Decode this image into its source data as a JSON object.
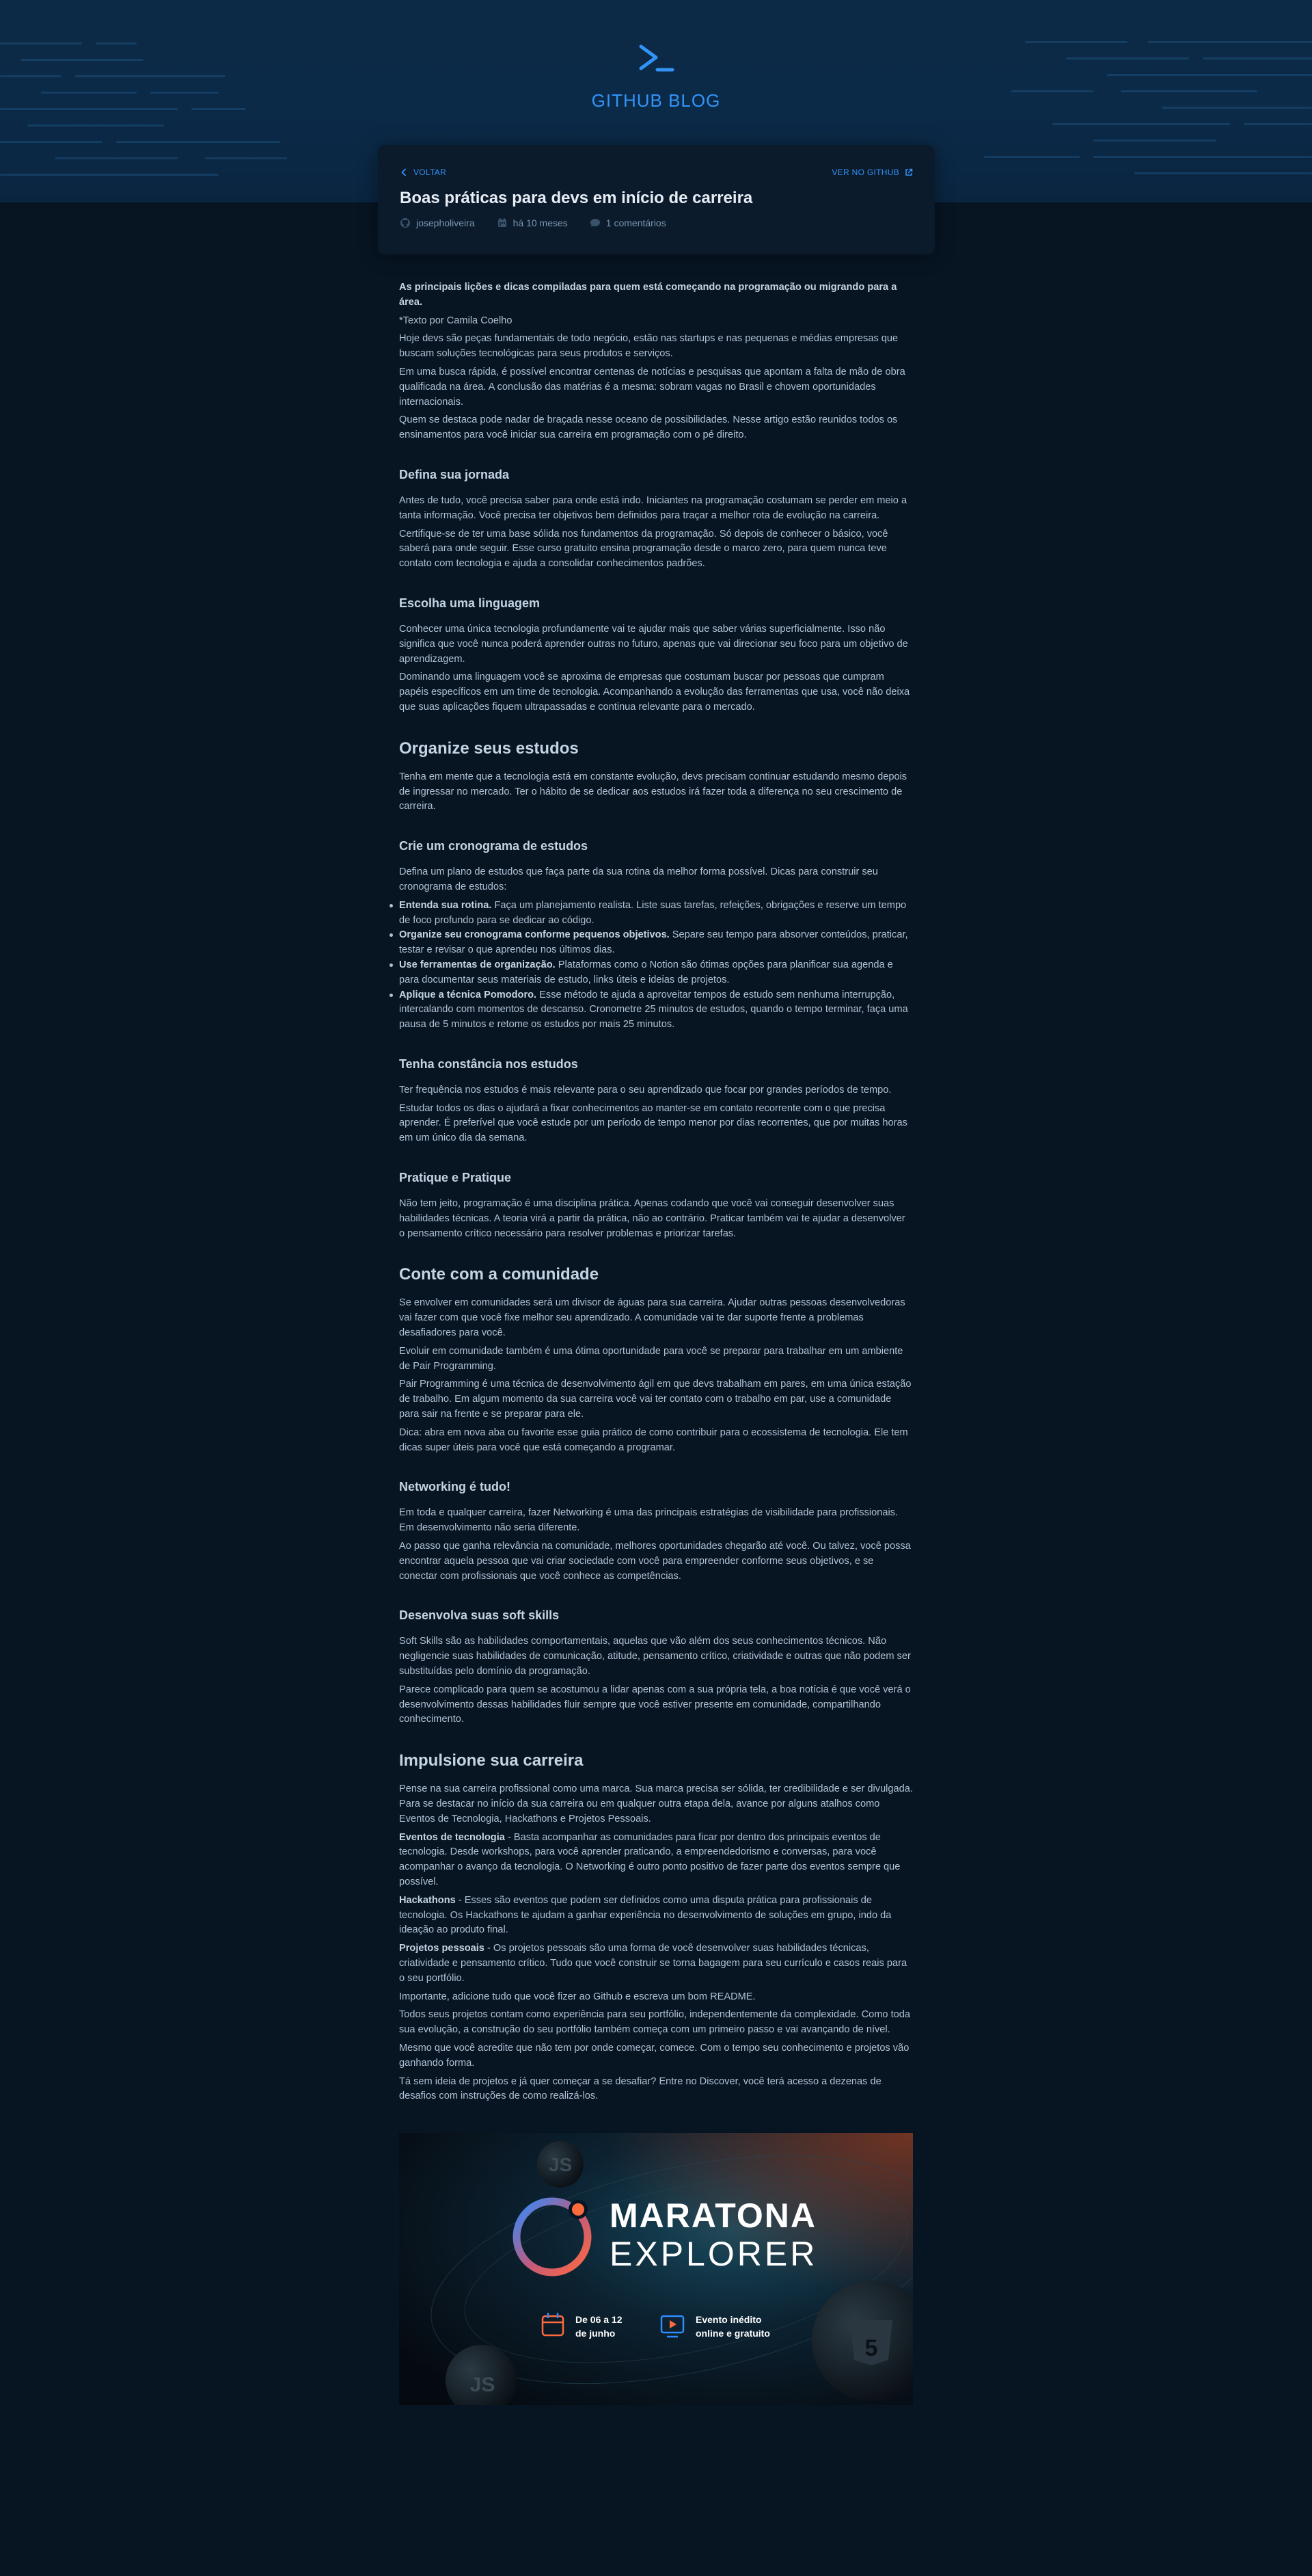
{
  "brand": {
    "name": "GITHUB BLOG",
    "accent": "#3294F8"
  },
  "post": {
    "back_label": "VOLTAR",
    "github_label": "VER NO GITHUB",
    "title": "Boas práticas para devs em início de carreira",
    "author": "josepholiveira",
    "date": "há 10 meses",
    "comments": "1 comentários"
  },
  "content": {
    "intro": {
      "lead": "As principais lições e dicas compiladas para quem está começando na programação ou migrando para a área.",
      "credit": "*Texto por Camila Coelho",
      "p1": "Hoje devs são peças fundamentais de todo negócio, estão nas startups e nas pequenas e médias empresas que buscam soluções tecnológicas para seus produtos e serviços.",
      "p2": "Em uma busca rápida, é possível encontrar centenas de notícias e pesquisas que apontam a falta de mão de obra qualificada na área. A conclusão das matérias é a mesma: sobram vagas no Brasil e chovem oportunidades internacionais.",
      "p3": "Quem se destaca pode nadar de braçada nesse oceano de possibilidades. Nesse artigo estão reunidos todos os ensinamentos para você iniciar sua carreira em programação com o pé direito."
    },
    "jornada": {
      "title": "Defina sua jornada",
      "p1": "Antes de tudo, você precisa saber para onde está indo. Iniciantes na programação costumam se perder em meio a tanta informação. Você precisa ter objetivos bem definidos para traçar a melhor rota de evolução na carreira.",
      "p2": "Certifique-se de ter uma base sólida nos fundamentos da programação. Só depois de conhecer o básico, você saberá para onde seguir. Esse curso gratuito ensina programação desde o marco zero, para quem nunca teve contato com tecnologia e ajuda a consolidar conhecimentos padrões."
    },
    "linguagem": {
      "title": "Escolha uma linguagem",
      "p1": "Conhecer uma única tecnologia profundamente vai te ajudar mais que saber várias superficialmente. Isso não significa que você nunca poderá aprender outras no futuro, apenas que vai direcionar seu foco para um objetivo de aprendizagem.",
      "p2": "Dominando uma linguagem você se aproxima de empresas que costumam buscar por pessoas que cumpram papéis específicos em um time de tecnologia. Acompanhando a evolução das ferramentas que usa, você não deixa que suas aplicações fiquem ultrapassadas e continua relevante para o mercado."
    },
    "organize": {
      "title": "Organize seus estudos",
      "p1": "Tenha em mente que a tecnologia está em constante evolução, devs precisam continuar estudando mesmo depois de ingressar no mercado. Ter o hábito de se dedicar aos estudos irá fazer toda a diferença no seu crescimento de carreira."
    },
    "cronograma": {
      "title": "Crie um cronograma de estudos",
      "p1": "Defina um plano de estudos que faça parte da sua rotina da melhor forma possível. Dicas para construir seu cronograma de estudos:",
      "items": [
        {
          "bold": "Entenda sua rotina.",
          "text": " Faça um planejamento realista. Liste suas tarefas, refeições, obrigações e reserve um tempo de foco profundo para se dedicar ao código."
        },
        {
          "bold": "Organize seu cronograma conforme pequenos objetivos.",
          "text": " Separe seu tempo para absorver conteúdos, praticar, testar e revisar o que aprendeu nos últimos dias."
        },
        {
          "bold": "Use ferramentas de organização.",
          "text": " Plataformas como o Notion são ótimas opções para planificar sua agenda e para documentar seus materiais de estudo, links úteis e ideias de projetos."
        },
        {
          "bold": "Aplique a técnica Pomodoro.",
          "text": " Esse método te ajuda a aproveitar tempos de estudo sem nenhuma interrupção, intercalando com momentos de descanso. Cronometre 25 minutos de estudos, quando o tempo terminar, faça uma pausa de 5 minutos e retome os estudos por mais 25 minutos."
        }
      ]
    },
    "constancia": {
      "title": "Tenha constância nos estudos",
      "p1": "Ter frequência nos estudos é mais relevante para o seu aprendizado que focar por grandes períodos de tempo.",
      "p2": "Estudar todos os dias o ajudará a fixar conhecimentos ao manter-se em contato recorrente com o que precisa aprender. É preferível que você estude por um período de tempo menor por dias recorrentes, que por muitas horas em um único dia da semana."
    },
    "pratique": {
      "title": "Pratique e Pratique",
      "p1": "Não tem jeito, programação é uma disciplina prática. Apenas codando que você vai conseguir desenvolver suas habilidades técnicas. A teoria virá a partir da prática, não ao contrário. Praticar também vai te ajudar a desenvolver o pensamento crítico necessário para resolver problemas e priorizar tarefas."
    },
    "comunidade": {
      "title": "Conte com a comunidade",
      "p1": "Se envolver em comunidades será um divisor de águas para sua carreira. Ajudar outras pessoas desenvolvedoras vai fazer com que você fixe melhor seu aprendizado. A comunidade vai te dar suporte frente a problemas desafiadores para você.",
      "p2": "Evoluir em comunidade também é uma ótima oportunidade para você se preparar para trabalhar em um ambiente de Pair Programming.",
      "p3": "Pair Programming é uma técnica de desenvolvimento ágil em que devs trabalham em pares, em uma única estação de trabalho. Em algum momento da sua carreira você vai ter contato com o trabalho em par, use a comunidade para sair na frente e se preparar para ele.",
      "p4": "Dica: abra em nova aba ou favorite esse guia prático de como contribuir para o ecossistema de tecnologia. Ele tem dicas super úteis para você que está começando a programar."
    },
    "networking": {
      "title": "Networking é tudo!",
      "p1": "Em toda e qualquer carreira, fazer Networking é uma das principais estratégias de visibilidade para profissionais. Em desenvolvimento não seria diferente.",
      "p2": "Ao passo que ganha relevância na comunidade, melhores oportunidades chegarão até você. Ou talvez, você possa encontrar aquela pessoa que vai criar sociedade com você para empreender conforme seus objetivos, e se conectar com profissionais que você conhece as competências."
    },
    "softskills": {
      "title": "Desenvolva suas soft skills",
      "p1": "Soft Skills são as habilidades comportamentais, aquelas que vão além dos seus conhecimentos técnicos. Não negligencie suas habilidades de comunicação, atitude, pensamento crítico, criatividade e outras que não podem ser substituídas pelo domínio da programação.",
      "p2": "Parece complicado para quem se acostumou a lidar apenas com a sua própria tela, a boa notícia é que você verá o desenvolvimento dessas habilidades fluir sempre que você estiver presente em comunidade, compartilhando conhecimento."
    },
    "impulsione": {
      "title": "Impulsione sua carreira",
      "p1": "Pense na sua carreira profissional como uma marca. Sua marca precisa ser sólida, ter credibilidade e ser divulgada. Para se destacar no início da sua carreira ou em qualquer outra etapa dela, avance por alguns atalhos como Eventos de Tecnologia, Hackathons e Projetos Pessoais.",
      "eventos_bold": "Eventos de tecnologia",
      "eventos_text": " - Basta acompanhar as comunidades para ficar por dentro dos principais eventos de tecnologia. Desde workshops, para você aprender praticando, a empreendedorismo e conversas, para você acompanhar o avanço da tecnologia. O Networking é outro ponto positivo de fazer parte dos eventos sempre que possível.",
      "hack_bold": "Hackathons",
      "hack_text": " - Esses são eventos que podem ser definidos como uma disputa prática para profissionais de tecnologia. Os Hackathons te ajudam a ganhar experiência no desenvolvimento de soluções em grupo, indo da ideação ao produto final.",
      "proj_bold": "Projetos pessoais",
      "proj_text": " - Os projetos pessoais são uma forma de você desenvolver suas habilidades técnicas, criatividade e pensamento crítico. Tudo que você construir se torna bagagem para seu currículo e casos reais para o seu portfólio.",
      "p2": "Importante, adicione tudo que você fizer ao Github e escreva um bom README.",
      "p3": "Todos seus projetos contam como experiência para seu portfólio, independentemente da complexidade. Como toda sua evolução, a construção do seu portfólio também começa com um primeiro passo e vai avançando de nível.",
      "p4": "Mesmo que você acredite que não tem por onde começar, comece. Com o tempo seu conhecimento e projetos vão ganhando forma.",
      "p5": "Tá sem ideia de projetos e já quer começar a se desafiar? Entre no Discover, você terá acesso a dezenas de desafios com instruções de como realizá-los."
    }
  },
  "banner": {
    "title_line1": "MARATONA",
    "title_line2": "EXPLORER",
    "date_line1": "De 06 a 12",
    "date_line2": "de junho",
    "event_line1": "Evento  inédito",
    "event_line2": "online e gratuito",
    "badge_js": "JS",
    "badge_html": "5",
    "accent_orange": "#FF6A3D",
    "accent_blue": "#2F8CFF"
  }
}
